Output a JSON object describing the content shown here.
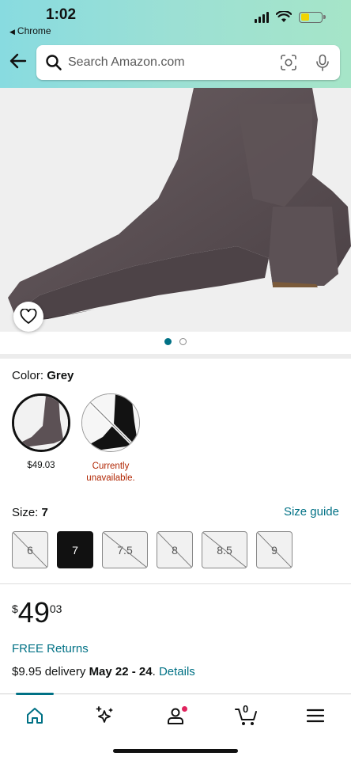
{
  "status_bar": {
    "time": "1:02",
    "back_app": "Chrome",
    "battery_color": "#f0d400"
  },
  "search": {
    "placeholder": "Search Amazon.com",
    "icons": [
      "back-arrow-icon",
      "search-icon",
      "camera-scan-icon",
      "microphone-icon"
    ]
  },
  "gallery": {
    "total_images": 2,
    "active_index": 0,
    "accent": "#007185"
  },
  "color": {
    "label": "Color:",
    "selected": "Grey",
    "options": [
      {
        "name": "Grey",
        "price": "$49.03",
        "available": true
      },
      {
        "name": "Black",
        "price": "Currently unavailable.",
        "available": false
      }
    ]
  },
  "size": {
    "label": "Size:",
    "selected": "7",
    "guide_link": "Size guide",
    "options": [
      {
        "label": "6",
        "available": false
      },
      {
        "label": "7",
        "available": true,
        "selected": true
      },
      {
        "label": "7.5",
        "available": false
      },
      {
        "label": "8",
        "available": false
      },
      {
        "label": "8.5",
        "available": false
      },
      {
        "label": "9",
        "available": false
      }
    ]
  },
  "price": {
    "symbol": "$",
    "whole": "49",
    "fraction": "03"
  },
  "shipping": {
    "returns": "FREE Returns",
    "delivery_prefix": "$9.95 delivery ",
    "delivery_dates": "May 22 - 24",
    "delivery_suffix": ". ",
    "details_link": "Details"
  },
  "bottom_nav": {
    "items": [
      "home-icon",
      "sparkle-icon",
      "account-icon",
      "cart-icon",
      "menu-icon"
    ],
    "cart_count": "0",
    "active": "home-icon"
  },
  "colors": {
    "link": "#007185",
    "unavailable": "#b12704",
    "header_gradient_start": "#88dbe0",
    "header_gradient_end": "#a6e5c8"
  }
}
